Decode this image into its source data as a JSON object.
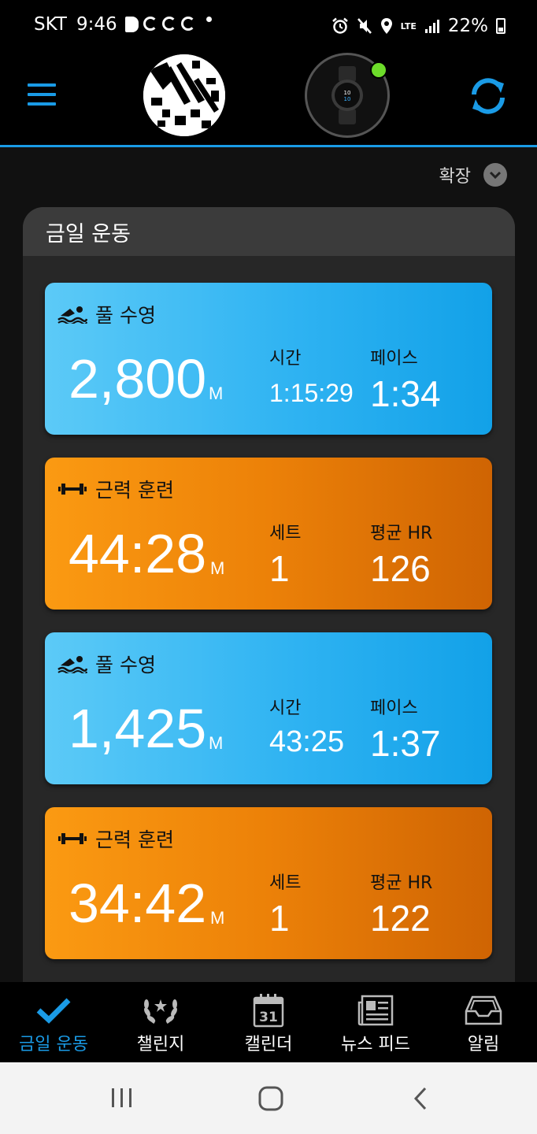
{
  "status_bar": {
    "carrier": "SKT",
    "time": "9:46",
    "network": "LTE",
    "battery": "22%"
  },
  "header": {
    "menu_icon": "hamburger-icon",
    "avatar_icon": "profile-avatar",
    "device_icon": "watch-icon",
    "device_status_color": "#6ddc2a",
    "sync_icon": "sync-icon",
    "accent": "#1a9be6"
  },
  "expand": {
    "label": "확장"
  },
  "panel": {
    "title": "금일 운동"
  },
  "activities": [
    {
      "type": "swim",
      "icon": "swim-icon",
      "label": "풀 수영",
      "value": "2,800",
      "unit": "M",
      "stat1_label": "시간",
      "stat1_value": "1:15:29",
      "stat2_label": "페이스",
      "stat2_value": "1:34"
    },
    {
      "type": "strength",
      "icon": "dumbbell-icon",
      "label": "근력 훈련",
      "value": "44:28",
      "unit": "M",
      "stat1_label": "세트",
      "stat1_value": "1",
      "stat2_label": "평균 HR",
      "stat2_value": "126"
    },
    {
      "type": "swim",
      "icon": "swim-icon",
      "label": "풀 수영",
      "value": "1,425",
      "unit": "M",
      "stat1_label": "시간",
      "stat1_value": "43:25",
      "stat2_label": "페이스",
      "stat2_value": "1:37"
    },
    {
      "type": "strength",
      "icon": "dumbbell-icon",
      "label": "근력 훈련",
      "value": "34:42",
      "unit": "M",
      "stat1_label": "세트",
      "stat1_value": "1",
      "stat2_label": "평균 HR",
      "stat2_value": "122"
    }
  ],
  "bottom_nav": [
    {
      "label": "금일 운동",
      "icon": "check-icon",
      "active": true
    },
    {
      "label": "챌린지",
      "icon": "laurel-icon",
      "active": false
    },
    {
      "label": "캘린더",
      "icon": "calendar-icon",
      "active": false,
      "icon_text": "31"
    },
    {
      "label": "뉴스 피드",
      "icon": "newspaper-icon",
      "active": false
    },
    {
      "label": "알림",
      "icon": "inbox-icon",
      "active": false
    }
  ],
  "system_nav": {
    "recents_icon": "recents-icon",
    "home_icon": "home-icon",
    "back_icon": "back-icon"
  }
}
